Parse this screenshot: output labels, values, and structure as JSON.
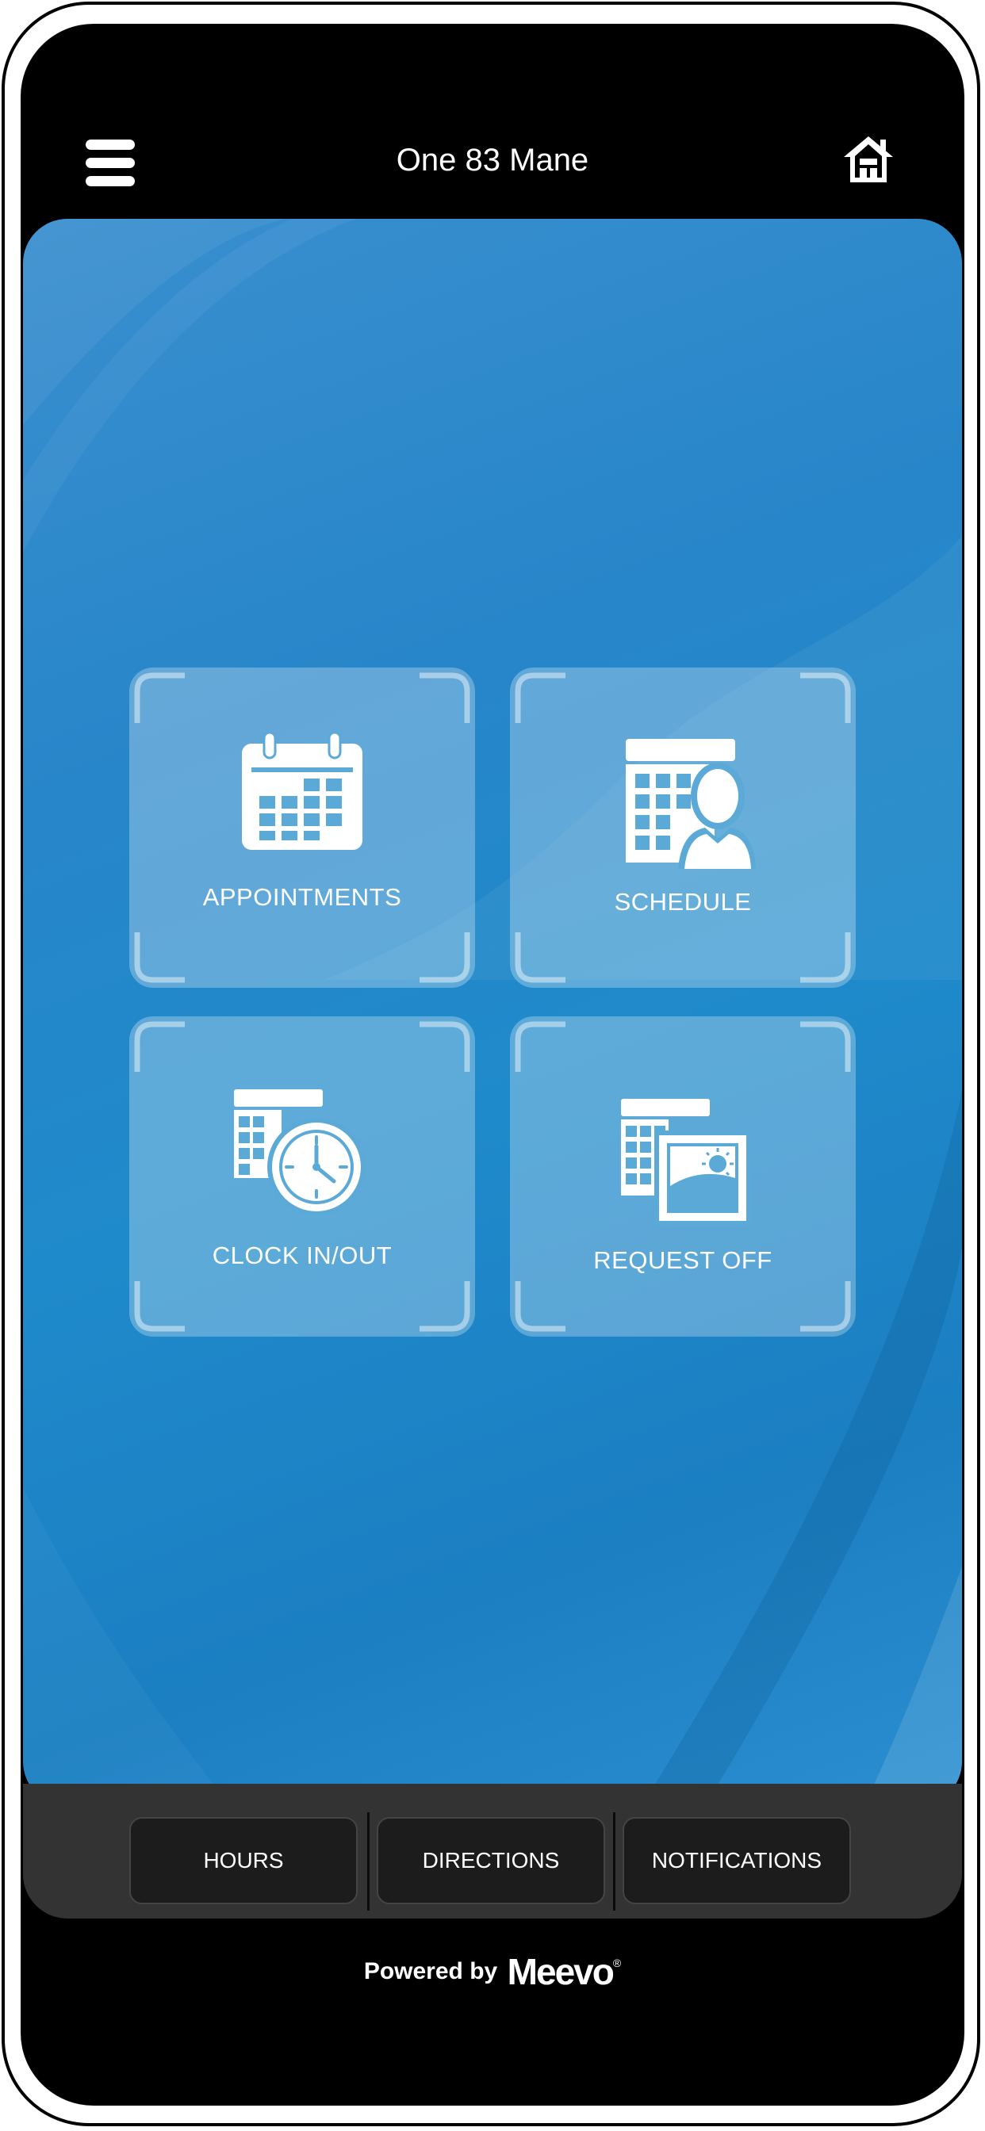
{
  "header": {
    "title": "One 83 Mane",
    "menu_icon": "hamburger-menu-icon",
    "home_icon": "home-icon"
  },
  "tiles": [
    {
      "label": "APPOINTMENTS",
      "icon": "calendar-icon"
    },
    {
      "label": "SCHEDULE",
      "icon": "schedule-person-icon"
    },
    {
      "label": "CLOCK IN/OUT",
      "icon": "clock-icon"
    },
    {
      "label": "REQUEST OFF",
      "icon": "request-off-icon"
    }
  ],
  "bottom_tabs": [
    {
      "label": "HOURS"
    },
    {
      "label": "DIRECTIONS"
    },
    {
      "label": "NOTIFICATIONS"
    }
  ],
  "footer": {
    "powered_by": "Powered by",
    "brand": "Meevo",
    "registered": "®"
  },
  "colors": {
    "accent": "#1f8acb",
    "background": "#000000",
    "bottom_bar": "#333333",
    "tab_button": "#1c1c1c"
  }
}
